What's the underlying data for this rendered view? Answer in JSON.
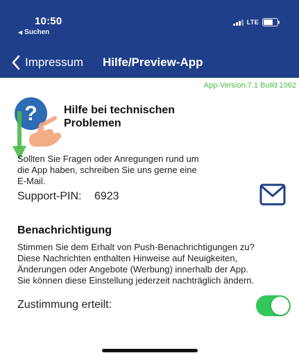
{
  "statusbar": {
    "time": "10:50",
    "back_app": "Suchen",
    "network": "LTE"
  },
  "nav": {
    "back_label": "Impressum",
    "title": "Hilfe/Preview-App"
  },
  "app_version": "App-Version:7.1 Build 1062",
  "help": {
    "icon_glyph": "?",
    "title_line1": "Hilfe bei technischen",
    "title_line2": "Problemen",
    "text_line1": "Sollten Sie Fragen oder Anregungen rund um",
    "text_line2": "die App haben, schreiben Sie uns gerne eine",
    "text_line3": "E-Mail.",
    "pin_label": "Support-PIN:",
    "pin_value": "6923"
  },
  "notification": {
    "title": "Benachrichtigung",
    "line1": "Stimmen Sie dem Erhalt von Push-Benachrichtigungen zu?",
    "line2": "Diese Nachrichten enthalten Hinweise auf Neuigkeiten,",
    "line3": "Änderungen oder Angebote (Werbung) innerhalb der App.",
    "line4": "Sie können diese Einstellung jederzeit nachträglich ändern.",
    "consent_label": "Zustimmung erteilt:",
    "consent_on": true
  },
  "colors": {
    "navbar": "#1f3f8a",
    "accent_green": "#34c759",
    "version_green": "#4cbb48",
    "help_icon": "#2e6cb3",
    "mail_icon": "#1f3f8a",
    "hand": "#f3a57c",
    "arrow": "#4cbb48"
  },
  "icons": {
    "back": "chevron-left-icon",
    "mail": "envelope-icon",
    "help": "question-circle-icon",
    "hand": "hand-pointer-icon",
    "arrow": "arrow-down-icon"
  }
}
